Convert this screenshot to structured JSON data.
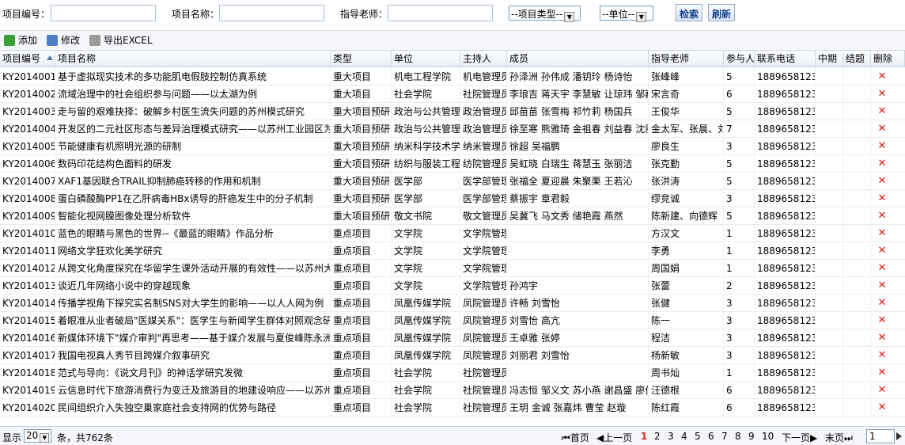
{
  "search": {
    "code_label": "项目编号：",
    "name_label": "项目名称：",
    "teacher_label": "指导老师：",
    "type_select": "--项目类型--",
    "unit_select": "--单位--",
    "search_button": "检索",
    "refresh_button": "刷新"
  },
  "toolbar": {
    "add": "添加",
    "edit": "修改",
    "export": "导出EXCEL"
  },
  "columns": [
    "项目编号",
    "项目名称",
    "类型",
    "单位",
    "主持人",
    "成员",
    "指导老师",
    "参与人",
    "联系电话",
    "中期",
    "结题",
    "删除"
  ],
  "rows": [
    [
      "KY2014001",
      "基于虚拟现实技术的多功能肌电假肢控制仿真系统",
      "重大项目",
      "机电工程学院",
      "机电管理员",
      "孙泽洲 孙伟成 潘钥玲 杨诗怡",
      "张峰峰",
      "5",
      "1889658123"
    ],
    [
      "KY2014002",
      "流域治理中的社会组织参与问题——以太湖为例",
      "重大项目",
      "社会学院",
      "社院管理员",
      "李琅吉 蒋天宇 李慧敏 让琼玮 邹巍",
      "宋言奇",
      "6",
      "1889658123"
    ],
    [
      "KY2014003",
      "走与留的艰难抉择：破解乡村医生流失问题的苏州模式研究",
      "重大项目预研",
      "政治与公共管理",
      "政治管理员",
      "邱苗苗 张雪梅 祁竹莉 杨国兵",
      "王俊华",
      "5",
      "1889658123"
    ],
    [
      "KY2014004",
      "开发区的二元社区形态与差异治理模式研究——以苏州工业园区为例",
      "重大项目预研",
      "政治与公共管理",
      "政治管理员",
      "徐至寒 熊雅琦 金祖春 刘益春 沈丽",
      "金太军、张晨、刘",
      "7",
      "1889658123"
    ],
    [
      "KY2014005",
      "节能健康有机照明光源的研制",
      "重大项目预研",
      "纳米科学技术学",
      "纳米管理员",
      "徐超 吴福鹏",
      "廖良生",
      "3",
      "1889658123"
    ],
    [
      "KY2014006",
      "数码印花结构色面料的研发",
      "重大项目预研",
      "纺织与服装工程",
      "纺院管理员",
      "吴虹晓 白瑞生 蒋慧玉 张丽洁",
      "张克勤",
      "5",
      "1889658123"
    ],
    [
      "KY2014007",
      "XAF1基因联合TRAIL抑制肺癌转移的作用和机制",
      "重大项目预研",
      "医学部",
      "医学部管理",
      "张福全 夏迎晨 朱聚栗 王若沁",
      "张洪涛",
      "5",
      "1889658123"
    ],
    [
      "KY2014008",
      "蛋白磷酸酶PP1在乙肝病毒HBx诱导的肝癌发生中的分子机制",
      "重大项目预研",
      "医学部",
      "医学部管理",
      "蔡振宇 章君毅",
      "缪竞诚",
      "3",
      "1889658123"
    ],
    [
      "KY2014009",
      "智能化视网膜图像处理分析软件",
      "重大项目预研",
      "敬文书院",
      "敬文管理员",
      "吴冀飞 马文秀 储艳霞 燕然",
      "陈新建、向德辉",
      "5",
      "1889658123"
    ],
    [
      "KY2014010",
      "蓝色的眼睛与黑色的世界--《最蓝的眼睛》作品分析",
      "重点项目",
      "文学院",
      "文学院管理",
      "",
      "方汉文",
      "1",
      "1889658123"
    ],
    [
      "KY2014011",
      "网络文学狂欢化美学研究",
      "重点项目",
      "文学院",
      "文学院管理",
      "",
      "李勇",
      "1",
      "1889658123"
    ],
    [
      "KY2014012",
      "从跨文化角度探究在华留学生课外活动开展的有效性——以苏州大学为例",
      "重点项目",
      "文学院",
      "文学院管理",
      "",
      "周国娟",
      "1",
      "1889658123"
    ],
    [
      "KY2014013",
      "谈近几年网络小说中的穿越现象",
      "重点项目",
      "文学院",
      "文学院管理",
      "孙鸿宇",
      "张蕾",
      "2",
      "1889658123"
    ],
    [
      "KY2014014",
      "传播学视角下探究实名制SNS对大学生的影响——以人人网为例",
      "重点项目",
      "凤凰传媒学院",
      "凤院管理员",
      "许畅 刘雪怡",
      "张健",
      "3",
      "1889658123"
    ],
    [
      "KY2014015",
      "着眼准从业者破局\"医媒关系\"：医学生与新闻学生群体对照观念研究",
      "重点项目",
      "凤凰传媒学院",
      "凤院管理员",
      "刘雪怡 高亢",
      "陈一",
      "3",
      "1889658123"
    ],
    [
      "KY2014016",
      "新媒体环境下\"媒介审判\"再思考——基于媒介发展与夏俊峰陈永洲",
      "重点项目",
      "凤凰传媒学院",
      "凤院管理员",
      "王卓雅 张婷",
      "程洁",
      "3",
      "1889658123"
    ],
    [
      "KY2014017",
      "我国电视真人秀节目跨媒介叙事研究",
      "重点项目",
      "凤凰传媒学院",
      "凤院管理员",
      "刘丽君 刘雪怡",
      "杨新敏",
      "3",
      "1889658123"
    ],
    [
      "KY2014018",
      "范式与导向：《说文月刊》的神话学研究发微",
      "重点项目",
      "社会学院",
      "社院管理员",
      "",
      "周书灿",
      "1",
      "1889658123"
    ],
    [
      "KY2014019",
      "云信息时代下旅游消费行为变迁及旅游目的地建设响应——以苏州为例",
      "重点项目",
      "社会学院",
      "社院管理员",
      "冯志恒 邹义文 苏小燕 谢昌盛 廖俊",
      "汪德根",
      "6",
      "1889658123"
    ],
    [
      "KY2014020",
      "民间组织介入失独空巢家庭社会支持网的优势与路径",
      "重点项目",
      "社会学院",
      "社院管理员",
      "王玥 金诚 张嘉炜 曹莹 赵璇",
      "陈红霞",
      "6",
      "1889658123"
    ]
  ],
  "pager": {
    "show": "显示",
    "page_size": "20",
    "total": "条，共762条",
    "first": "首页",
    "prev": "上一页",
    "pages": [
      "1",
      "2",
      "3",
      "4",
      "5",
      "6",
      "7",
      "8",
      "9",
      "10"
    ],
    "next": "下一页",
    "last": "末页",
    "current": "1"
  },
  "colors": {
    "accent": "#15428b",
    "current_page": "#e02020",
    "delete_icon": "#d81818"
  }
}
